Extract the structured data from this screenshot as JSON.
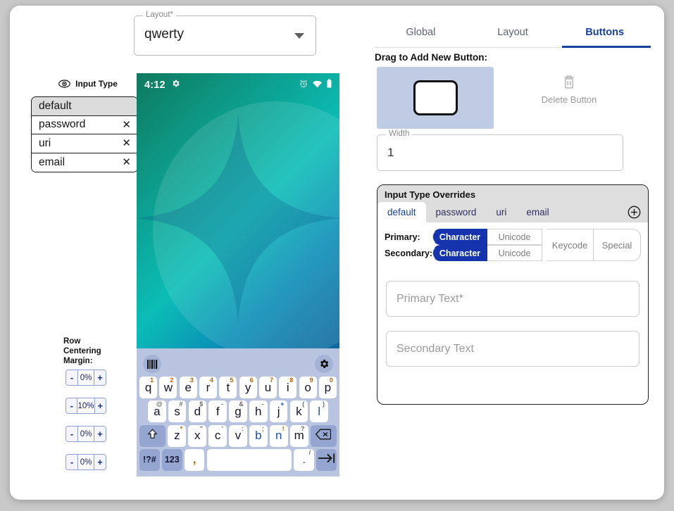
{
  "left": {
    "layout_select": {
      "legend": "Layout*",
      "value": "qwerty"
    },
    "input_type": {
      "header": "Input Type",
      "items": [
        {
          "label": "default",
          "selected": true,
          "removable": false
        },
        {
          "label": "password",
          "selected": false,
          "removable": true
        },
        {
          "label": "uri",
          "selected": false,
          "removable": true
        },
        {
          "label": "email",
          "selected": false,
          "removable": true
        }
      ],
      "remove_glyph": "✕"
    },
    "row_centering": {
      "label": "Row Centering Margin:",
      "minus": "-",
      "plus": "+",
      "values": [
        "0%",
        "10%",
        "0%",
        "0%"
      ]
    }
  },
  "phone": {
    "status": {
      "time": "4:12",
      "gear_icon": "gear-icon",
      "alarm_icon": "alarm-icon",
      "wifi_icon": "wifi-icon",
      "battery_icon": "battery-icon"
    },
    "keyboard": {
      "toolbar": {
        "left_icon": "barcode-icon",
        "right_icon": "gear-icon"
      },
      "row1": [
        {
          "label": "q",
          "sup": "1"
        },
        {
          "label": "w",
          "sup": "2"
        },
        {
          "label": "e",
          "sup": "3"
        },
        {
          "label": "r",
          "sup": "4"
        },
        {
          "label": "t",
          "sup": "5"
        },
        {
          "label": "y",
          "sup": "6"
        },
        {
          "label": "u",
          "sup": "7"
        },
        {
          "label": "i",
          "sup": "8"
        },
        {
          "label": "o",
          "sup": "9"
        },
        {
          "label": "p",
          "sup": "0"
        }
      ],
      "row2": [
        {
          "label": "a",
          "sup": "@"
        },
        {
          "label": "s",
          "sup": "#"
        },
        {
          "label": "d",
          "sup": "$"
        },
        {
          "label": "f",
          "sup": "-"
        },
        {
          "label": "g",
          "sup": "&"
        },
        {
          "label": "h",
          "sup": "-"
        },
        {
          "label": "j",
          "sup": "+"
        },
        {
          "label": "k",
          "sup": "("
        },
        {
          "label": "l",
          "sup": ")"
        }
      ],
      "row3": [
        {
          "label": "z",
          "sup": "*"
        },
        {
          "label": "x",
          "sup": "\""
        },
        {
          "label": "c",
          "sup": "'"
        },
        {
          "label": "v",
          "sup": ":"
        },
        {
          "label": "b",
          "sup": ";"
        },
        {
          "label": "n",
          "sup": "!"
        },
        {
          "label": "m",
          "sup": "?"
        }
      ],
      "shift": "shift-icon",
      "backspace": "backspace-icon",
      "symbols_key": "!?#",
      "numbers_key": "123",
      "comma_key": ",",
      "space_key": "",
      "period_key": ".",
      "period_sup": "/",
      "enter_key": "tab-enter-icon"
    }
  },
  "right": {
    "tabs": [
      {
        "label": "Global",
        "active": false
      },
      {
        "label": "Layout",
        "active": false
      },
      {
        "label": "Buttons",
        "active": true
      }
    ],
    "drag_label": "Drag to Add New Button:",
    "delete_button": {
      "label": "Delete Button",
      "icon": "trash-icon"
    },
    "width_field": {
      "legend": "Width",
      "value": "1"
    },
    "overrides": {
      "title": "Input Type Overrides",
      "tabs": [
        {
          "label": "default",
          "active": true
        },
        {
          "label": "password",
          "active": false
        },
        {
          "label": "uri",
          "active": false
        },
        {
          "label": "email",
          "active": false
        }
      ],
      "add_icon": "plus-circle-icon",
      "rows": [
        {
          "label": "Primary:",
          "options": [
            {
              "label": "Character",
              "selected": true
            },
            {
              "label": "Unicode",
              "selected": false
            }
          ]
        },
        {
          "label": "Secondary:",
          "options": [
            {
              "label": "Character",
              "selected": true
            },
            {
              "label": "Unicode",
              "selected": false
            }
          ]
        }
      ],
      "tall_options": [
        {
          "label": "Keycode",
          "selected": false
        },
        {
          "label": "Special",
          "selected": false
        }
      ],
      "primary_text_placeholder": "Primary Text*",
      "secondary_text_placeholder": "Secondary Text"
    }
  },
  "colors": {
    "accent_blue": "#17409c",
    "segment_on": "#1433ad",
    "keyboard_bg": "#b9c4e0",
    "drag_area": "#bfcce3"
  }
}
